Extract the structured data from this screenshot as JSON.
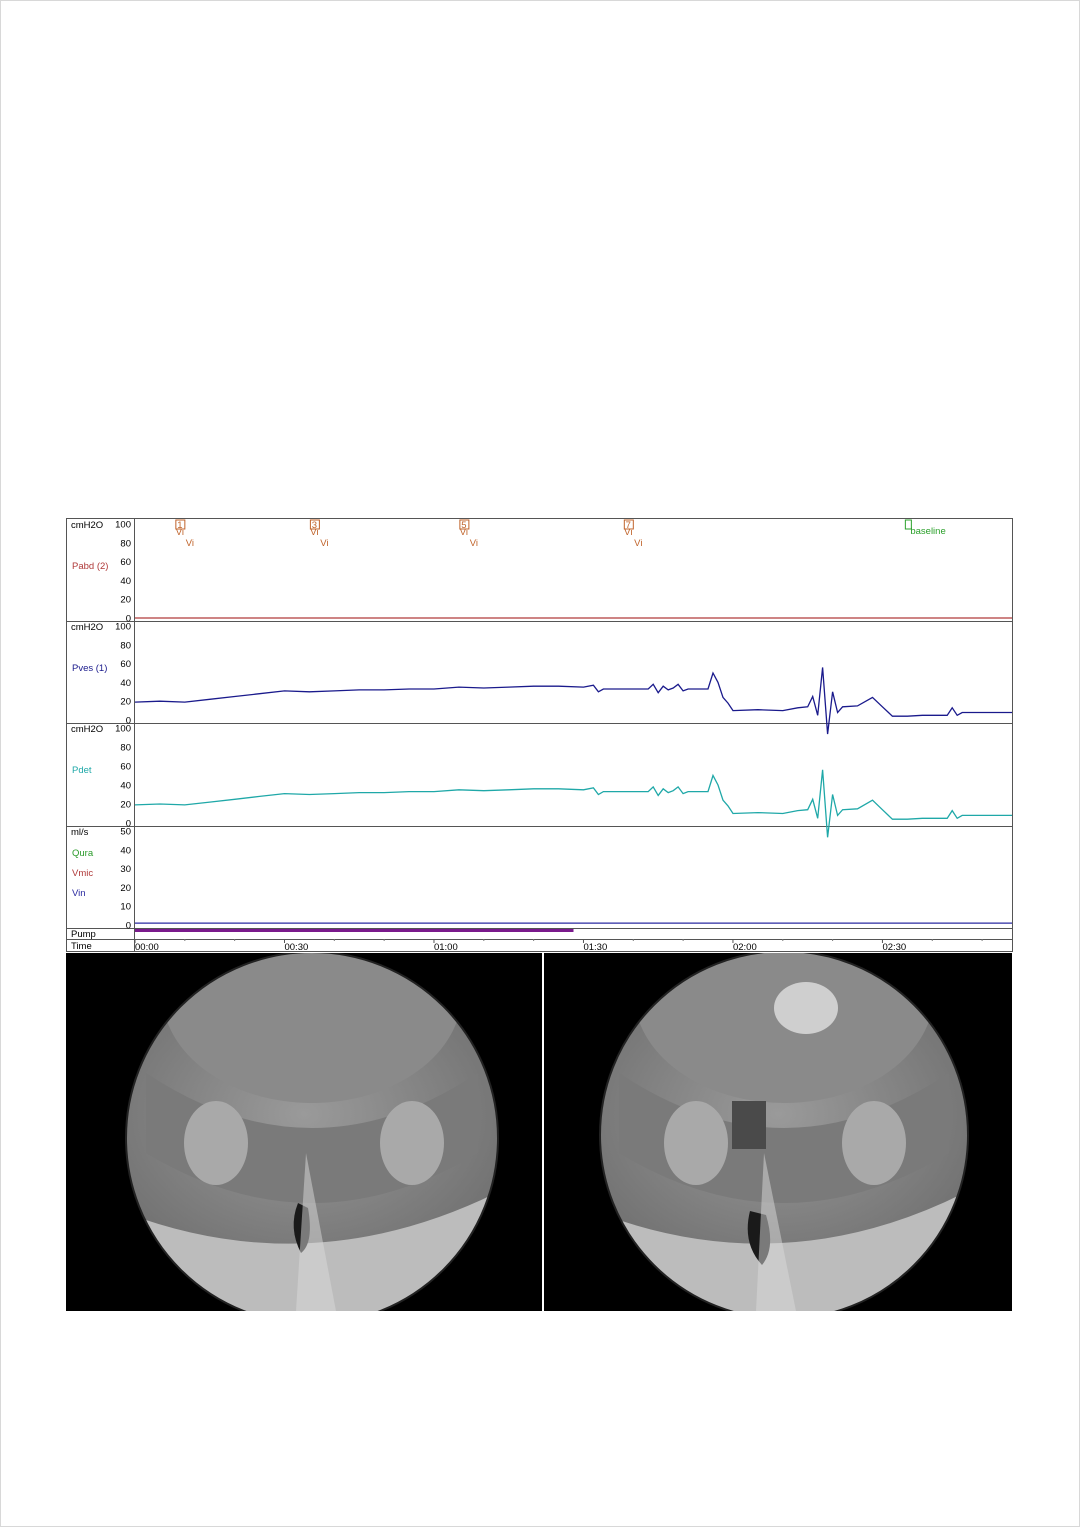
{
  "chart_data": {
    "type": "line",
    "time_ticks": [
      "00:00",
      "00:30",
      "01:00",
      "01:30",
      "02:00",
      "02:30"
    ],
    "time_tick_values_s": [
      0,
      30,
      60,
      90,
      120,
      150
    ],
    "time_range_s": [
      0,
      176
    ],
    "channels": [
      {
        "id": "pabd",
        "name": "Pabd (2)",
        "unit": "cmH2O",
        "color": "#b03a3a",
        "ylim": [
          0,
          100
        ],
        "ticks": [
          "100",
          "80",
          "60",
          "40",
          "20",
          "0"
        ],
        "tick_values": [
          100,
          80,
          60,
          40,
          20,
          0
        ],
        "points": [
          [
            0,
            0
          ],
          [
            176,
            0
          ]
        ]
      },
      {
        "id": "pves",
        "name": "Pves (1)",
        "unit": "cmH2O",
        "color": "#1a1a8c",
        "ylim": [
          0,
          100
        ],
        "ticks": [
          "100",
          "80",
          "60",
          "40",
          "20",
          "0"
        ],
        "tick_values": [
          100,
          80,
          60,
          40,
          20,
          0
        ],
        "points": [
          [
            0,
            19
          ],
          [
            5,
            20
          ],
          [
            10,
            19
          ],
          [
            15,
            22
          ],
          [
            20,
            25
          ],
          [
            25,
            28
          ],
          [
            30,
            31
          ],
          [
            35,
            30
          ],
          [
            40,
            31
          ],
          [
            45,
            32
          ],
          [
            50,
            32
          ],
          [
            55,
            33
          ],
          [
            60,
            33
          ],
          [
            65,
            35
          ],
          [
            70,
            34
          ],
          [
            75,
            35
          ],
          [
            80,
            36
          ],
          [
            85,
            36
          ],
          [
            90,
            35
          ],
          [
            92,
            37
          ],
          [
            93,
            30
          ],
          [
            94,
            33
          ],
          [
            98,
            33
          ],
          [
            103,
            33
          ],
          [
            104,
            38
          ],
          [
            105,
            29
          ],
          [
            106,
            36
          ],
          [
            107,
            32
          ],
          [
            108,
            34
          ],
          [
            109,
            38
          ],
          [
            110,
            31
          ],
          [
            111,
            33
          ],
          [
            115,
            33
          ],
          [
            116,
            50
          ],
          [
            117,
            40
          ],
          [
            118,
            24
          ],
          [
            119,
            18
          ],
          [
            120,
            10
          ],
          [
            125,
            11
          ],
          [
            130,
            10
          ],
          [
            133,
            13
          ],
          [
            135,
            14
          ],
          [
            136,
            25
          ],
          [
            137,
            5
          ],
          [
            138,
            56
          ],
          [
            139,
            -15
          ],
          [
            140,
            30
          ],
          [
            141,
            8
          ],
          [
            142,
            14
          ],
          [
            145,
            15
          ],
          [
            148,
            24
          ],
          [
            150,
            14
          ],
          [
            152,
            4
          ],
          [
            155,
            4
          ],
          [
            158,
            5
          ],
          [
            163,
            5
          ],
          [
            164,
            13
          ],
          [
            165,
            5
          ],
          [
            166,
            8
          ],
          [
            170,
            8
          ],
          [
            176,
            8
          ]
        ]
      },
      {
        "id": "pdet",
        "name": "Pdet",
        "unit": "cmH2O",
        "color": "#1fa8a8",
        "ylim": [
          0,
          100
        ],
        "ticks": [
          "100",
          "80",
          "60",
          "40",
          "20",
          "0"
        ],
        "tick_values": [
          100,
          80,
          60,
          40,
          20,
          0
        ],
        "points": [
          [
            0,
            19
          ],
          [
            5,
            20
          ],
          [
            10,
            19
          ],
          [
            15,
            22
          ],
          [
            20,
            25
          ],
          [
            25,
            28
          ],
          [
            30,
            31
          ],
          [
            35,
            30
          ],
          [
            40,
            31
          ],
          [
            45,
            32
          ],
          [
            50,
            32
          ],
          [
            55,
            33
          ],
          [
            60,
            33
          ],
          [
            65,
            35
          ],
          [
            70,
            34
          ],
          [
            75,
            35
          ],
          [
            80,
            36
          ],
          [
            85,
            36
          ],
          [
            90,
            35
          ],
          [
            92,
            37
          ],
          [
            93,
            30
          ],
          [
            94,
            33
          ],
          [
            98,
            33
          ],
          [
            103,
            33
          ],
          [
            104,
            38
          ],
          [
            105,
            29
          ],
          [
            106,
            36
          ],
          [
            107,
            32
          ],
          [
            108,
            34
          ],
          [
            109,
            38
          ],
          [
            110,
            31
          ],
          [
            111,
            33
          ],
          [
            115,
            33
          ],
          [
            116,
            50
          ],
          [
            117,
            40
          ],
          [
            118,
            24
          ],
          [
            119,
            18
          ],
          [
            120,
            10
          ],
          [
            125,
            11
          ],
          [
            130,
            10
          ],
          [
            133,
            13
          ],
          [
            135,
            14
          ],
          [
            136,
            25
          ],
          [
            137,
            5
          ],
          [
            138,
            56
          ],
          [
            139,
            -15
          ],
          [
            140,
            30
          ],
          [
            141,
            8
          ],
          [
            142,
            14
          ],
          [
            145,
            15
          ],
          [
            148,
            24
          ],
          [
            150,
            14
          ],
          [
            152,
            4
          ],
          [
            155,
            4
          ],
          [
            158,
            5
          ],
          [
            163,
            5
          ],
          [
            164,
            13
          ],
          [
            165,
            5
          ],
          [
            166,
            8
          ],
          [
            170,
            8
          ],
          [
            176,
            8
          ]
        ]
      },
      {
        "id": "flow",
        "unit": "ml/s",
        "ylim": [
          0,
          50
        ],
        "ticks": [
          "50",
          "40",
          "30",
          "20",
          "10",
          "0"
        ],
        "tick_values": [
          50,
          40,
          30,
          20,
          10,
          0
        ],
        "series_labels": [
          {
            "name": "Qura",
            "color": "#2a9a2a"
          },
          {
            "name": "Vmic",
            "color": "#b03a3a"
          },
          {
            "name": "Vin",
            "color": "#2a2aa0"
          }
        ],
        "lines": [
          {
            "color": "#2a2aa0",
            "points": [
              [
                0,
                1
              ],
              [
                176,
                1
              ]
            ]
          }
        ]
      }
    ],
    "pump": {
      "label": "Pump",
      "color": "#7a1a8c",
      "on_range_s": [
        0,
        88
      ]
    },
    "time_label": "Time",
    "markers": [
      {
        "t": 9,
        "top": "1",
        "sub": "Vi",
        "mid": "Vi"
      },
      {
        "t": 36,
        "top": "3",
        "sub": "Vi",
        "mid": "Vi"
      },
      {
        "t": 66,
        "top": "5",
        "sub": "Vi",
        "mid": "Vi"
      },
      {
        "t": 99,
        "top": "7",
        "sub": "Vi",
        "mid": "Vi"
      }
    ],
    "marker_color": "#c0632a",
    "event": {
      "t": 155,
      "label": "baseline",
      "color": "#2aa02a"
    }
  }
}
